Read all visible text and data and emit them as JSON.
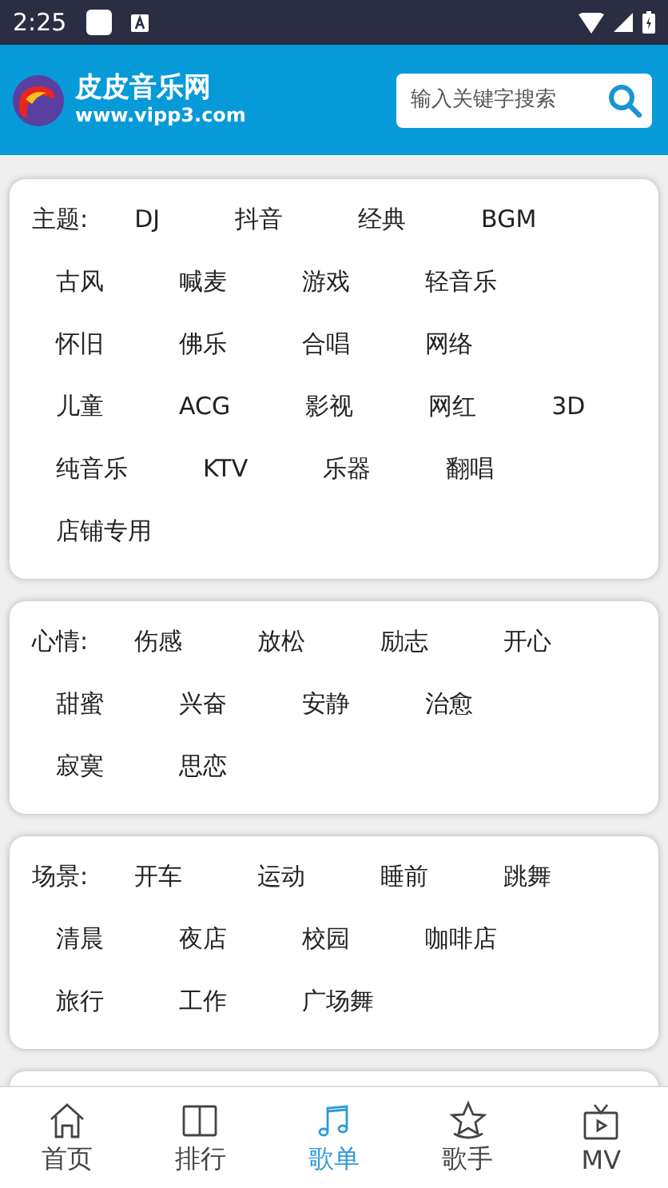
{
  "status_bar": {
    "time": "2:25"
  },
  "header": {
    "site_name": "皮皮音乐网",
    "site_url": "www.vipp3.com",
    "search": {
      "placeholder": "输入关键字搜索"
    }
  },
  "categories": [
    {
      "label": "主题:",
      "tags": [
        "DJ",
        "抖音",
        "经典",
        "BGM",
        "古风",
        "喊麦",
        "游戏",
        "轻音乐",
        "怀旧",
        "佛乐",
        "合唱",
        "网络",
        "儿童",
        "ACG",
        "影视",
        "网红",
        "3D",
        "纯音乐",
        "KTV",
        "乐器",
        "翻唱",
        "店铺专用"
      ]
    },
    {
      "label": "心情:",
      "tags": [
        "伤感",
        "放松",
        "励志",
        "开心",
        "甜蜜",
        "兴奋",
        "安静",
        "治愈",
        "寂寞",
        "思恋"
      ]
    },
    {
      "label": "场景:",
      "tags": [
        "开车",
        "运动",
        "睡前",
        "跳舞",
        "清晨",
        "夜店",
        "校园",
        "咖啡店",
        "旅行",
        "工作",
        "广场舞"
      ]
    }
  ],
  "bottom_nav": [
    {
      "label": "首页",
      "selected": false
    },
    {
      "label": "排行",
      "selected": false
    },
    {
      "label": "歌单",
      "selected": true
    },
    {
      "label": "歌手",
      "selected": false
    },
    {
      "label": "MV",
      "selected": false
    }
  ]
}
